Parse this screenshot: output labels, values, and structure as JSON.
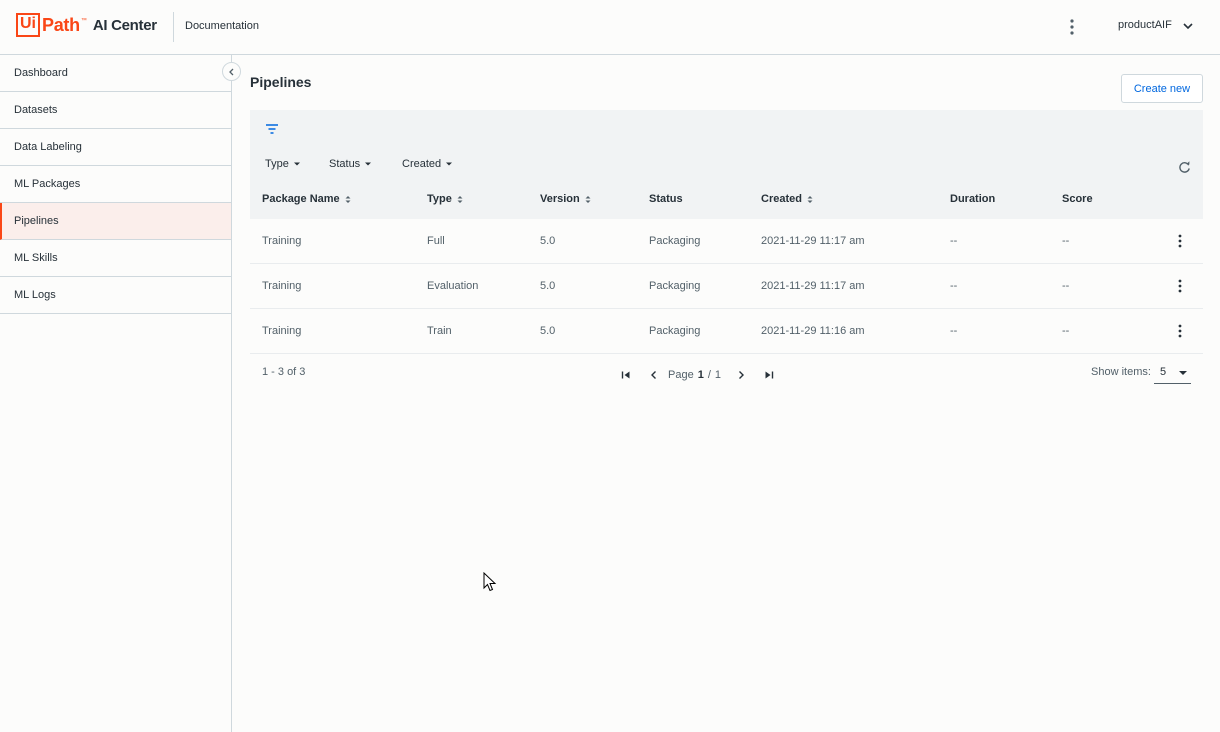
{
  "header": {
    "logo_ui": "Ui",
    "logo_path": "Path",
    "logo_tm": "™",
    "product": "AI Center",
    "doc_link": "Documentation",
    "tenant": "productAIF"
  },
  "sidebar": {
    "items": [
      {
        "label": "Dashboard",
        "active": false
      },
      {
        "label": "Datasets",
        "active": false
      },
      {
        "label": "Data Labeling",
        "active": false
      },
      {
        "label": "ML Packages",
        "active": false
      },
      {
        "label": "Pipelines",
        "active": true
      },
      {
        "label": "ML Skills",
        "active": false
      },
      {
        "label": "ML Logs",
        "active": false
      }
    ]
  },
  "main": {
    "title": "Pipelines",
    "create_label": "Create new",
    "filters": [
      "Type",
      "Status",
      "Created"
    ],
    "columns": [
      "Package Name",
      "Type",
      "Version",
      "Status",
      "Created",
      "Duration",
      "Score"
    ],
    "rows": [
      {
        "package": "Training",
        "type": "Full",
        "version": "5.0",
        "status": "Packaging",
        "created": "2021-11-29 11:17 am",
        "duration": "--",
        "score": "--"
      },
      {
        "package": "Training",
        "type": "Evaluation",
        "version": "5.0",
        "status": "Packaging",
        "created": "2021-11-29 11:17 am",
        "duration": "--",
        "score": "--"
      },
      {
        "package": "Training",
        "type": "Train",
        "version": "5.0",
        "status": "Packaging",
        "created": "2021-11-29 11:16 am",
        "duration": "--",
        "score": "--"
      }
    ],
    "pagination": {
      "range": "1 - 3 of 3",
      "page_label": "Page",
      "current": "1",
      "separator": "/",
      "total": "1",
      "show_label": "Show items:",
      "page_size": "5"
    }
  },
  "colors": {
    "accent": "#fa4616",
    "link": "#0067df",
    "active_bg": "#fbeeeb",
    "grid_header_bg": "#f1f3f4"
  },
  "icons": [
    "kebab-icon",
    "chevron-down-icon",
    "chevron-left-icon",
    "filter-icon",
    "caret-down-icon",
    "sort-icon",
    "refresh-icon",
    "first-page-icon",
    "prev-page-icon",
    "next-page-icon",
    "last-page-icon",
    "cursor-icon"
  ]
}
